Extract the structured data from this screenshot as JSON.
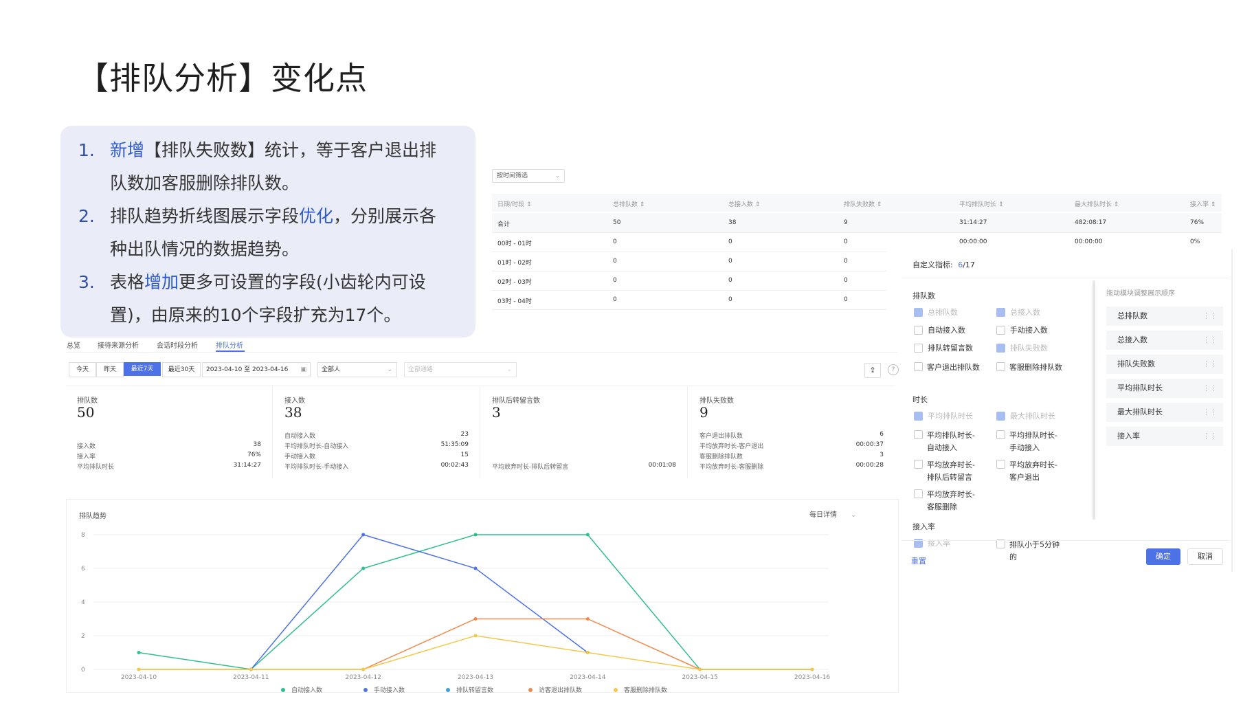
{
  "title": "【排队分析】变化点",
  "notes": [
    {
      "num": "1.",
      "lines": [
        [
          {
            "t": "新增",
            "hl": true
          },
          {
            "t": "【排队失败数】统计，等于客户退出排"
          }
        ],
        [
          {
            "t": "队数加客服删除排队数。"
          }
        ]
      ]
    },
    {
      "num": "2.",
      "lines": [
        [
          {
            "t": "排队趋势折线图展示字段"
          },
          {
            "t": "优化",
            "hl": true
          },
          {
            "t": "，分别展示各"
          }
        ],
        [
          {
            "t": "种出队情况的数据趋势。"
          }
        ]
      ]
    },
    {
      "num": "3.",
      "lines": [
        [
          {
            "t": "表格"
          },
          {
            "t": "增加",
            "hl": true
          },
          {
            "t": "更多可设置的字段(小齿轮内可设"
          }
        ],
        [
          {
            "t": "置)，由原来的10个字段扩充为17个。"
          }
        ]
      ]
    }
  ],
  "table": {
    "filter": "按时间筛选",
    "headers": [
      "日期/时段 ⇕",
      "总排队数 ⇕",
      "总接入数 ⇕",
      "排队失败数 ⇕",
      "平均排队时长 ⇕",
      "最大排队时长 ⇕",
      "接入率 ⇕"
    ],
    "rows": [
      [
        "合计",
        "50",
        "38",
        "9",
        "31:14:27",
        "482:08:17",
        "76%"
      ],
      [
        "00时 - 01时",
        "0",
        "0",
        "0",
        "00:00:00",
        "00:00:00",
        "0%"
      ],
      [
        "01时 - 02时",
        "0",
        "0",
        "0",
        "",
        "",
        ""
      ],
      [
        "02时 - 03时",
        "0",
        "0",
        "0",
        "",
        "",
        ""
      ],
      [
        "03时 - 04时",
        "0",
        "0",
        "0",
        "",
        "",
        ""
      ]
    ]
  },
  "tabs": [
    "总览",
    "接待来源分析",
    "会话时段分析",
    "排队分析"
  ],
  "filters": {
    "quick": [
      "今天",
      "昨天",
      "最近7天",
      "最近30天"
    ],
    "date_range": "2023-04-10 至 2023-04-16",
    "group": "全部人",
    "channel_placeholder": "全部通路"
  },
  "cards": [
    {
      "label": "排队数",
      "value": "50",
      "rows": [
        [
          "接入数",
          "38"
        ],
        [
          "接入率",
          "76%"
        ],
        [
          "平均排队时长",
          "31:14:27"
        ]
      ]
    },
    {
      "label": "接入数",
      "value": "38",
      "rows": [
        [
          "自动接入数",
          "23"
        ],
        [
          "平均排队时长-自动接入",
          "51:35:09"
        ],
        [
          "手动接入数",
          "15"
        ],
        [
          "平均排队时长-手动接入",
          "00:02:43"
        ]
      ]
    },
    {
      "label": "排队后转留言数",
      "value": "3",
      "rows": [
        [
          "平均放弃时长-排队后转留言",
          "00:01:08"
        ]
      ]
    },
    {
      "label": "排队失败数",
      "value": "9",
      "rows": [
        [
          "客户退出排队数",
          "6"
        ],
        [
          "平均放弃时长-客户退出",
          "00:00:37"
        ],
        [
          "客服删除排队数",
          "3"
        ],
        [
          "平均放弃时长-客服删除",
          "00:00:28"
        ]
      ]
    }
  ],
  "trend": {
    "title": "排队趋势",
    "detail": "每日详情"
  },
  "chart_data": {
    "type": "line",
    "x": [
      "2023-04-10",
      "2023-04-11",
      "2023-04-12",
      "2023-04-13",
      "2023-04-14",
      "2023-04-15",
      "2023-04-16"
    ],
    "ylim": [
      0,
      8
    ],
    "yticks": [
      0,
      2,
      4,
      6,
      8
    ],
    "series": [
      {
        "name": "自动接入数",
        "color": "#2fbf8a",
        "values": [
          1,
          0,
          6,
          8,
          8,
          0,
          0
        ]
      },
      {
        "name": "手动接入数",
        "color": "#4d72e8",
        "values": [
          null,
          0,
          8,
          6,
          1,
          null,
          null
        ]
      },
      {
        "name": "排队转留言数",
        "color": "#3aa3e0",
        "values": [
          null,
          null,
          null,
          null,
          null,
          null,
          null
        ]
      },
      {
        "name": "访客退出排队数",
        "color": "#f08a4b",
        "values": [
          0,
          0,
          0,
          3,
          3,
          0,
          0
        ]
      },
      {
        "name": "客服删除排队数",
        "color": "#f2c94c",
        "values": [
          0,
          0,
          0,
          2,
          1,
          0,
          0
        ]
      }
    ]
  },
  "settings": {
    "custom_label": "自定义指标:",
    "count": "6",
    "total": "/17",
    "groups": [
      {
        "name": "排队数",
        "items": [
          {
            "label": "总排队数",
            "checked": true,
            "disabled": true
          },
          {
            "label": "总接入数",
            "checked": true,
            "disabled": true
          },
          {
            "label": "自动接入数",
            "checked": false
          },
          {
            "label": "手动接入数",
            "checked": false
          },
          {
            "label": "排队转留言数",
            "checked": false
          },
          {
            "label": "排队失败数",
            "checked": true,
            "disabled": true
          },
          {
            "label": "客户退出排队数",
            "checked": false
          },
          {
            "label": "客服删除排队数",
            "checked": false
          }
        ]
      },
      {
        "name": "时长",
        "items": [
          {
            "label": "平均排队时长",
            "checked": true,
            "disabled": true
          },
          {
            "label": "最大排队时长",
            "checked": true,
            "disabled": true
          },
          {
            "label": "平均排队时长-自动接入",
            "checked": false
          },
          {
            "label": "平均排队时长-手动接入",
            "checked": false
          },
          {
            "label": "平均放弃时长-排队后转留言",
            "checked": false
          },
          {
            "label": "平均放弃时长-客户退出",
            "checked": false
          },
          {
            "label": "平均放弃时长-客服删除",
            "checked": false
          }
        ]
      },
      {
        "name": "接入率",
        "items": [
          {
            "label": "接入率",
            "checked": true,
            "disabled": true
          },
          {
            "label": "排队小于5分钟的",
            "checked": false
          }
        ]
      }
    ],
    "order_title": "拖动模块调整展示顺序",
    "order": [
      "总排队数",
      "总接入数",
      "排队失败数",
      "平均排队时长",
      "最大排队时长",
      "接入率"
    ],
    "reset": "重置",
    "confirm": "确定",
    "cancel": "取消"
  },
  "colors": {
    "accent": "#4d72e8",
    "highlight": "#2f5bd0",
    "panel": "#eaedf8"
  }
}
